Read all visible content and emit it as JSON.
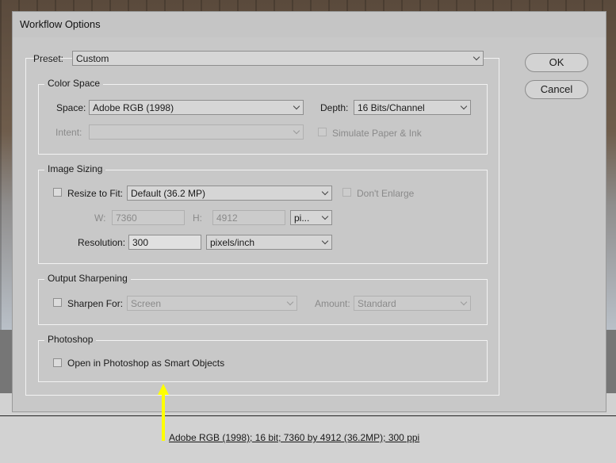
{
  "dialog": {
    "title": "Workflow Options",
    "preset": {
      "label": "Preset:",
      "value": "Custom"
    },
    "ok_label": "OK",
    "cancel_label": "Cancel",
    "color_space": {
      "title": "Color Space",
      "space_label": "Space:",
      "space_value": "Adobe RGB (1998)",
      "depth_label": "Depth:",
      "depth_value": "16 Bits/Channel",
      "intent_label": "Intent:",
      "intent_value": "",
      "simulate_label": "Simulate Paper & Ink"
    },
    "image_sizing": {
      "title": "Image Sizing",
      "resize_label": "Resize to Fit:",
      "resize_value": "Default  (36.2 MP)",
      "dont_enlarge_label": "Don't Enlarge",
      "w_label": "W:",
      "w_value": "7360",
      "h_label": "H:",
      "h_value": "4912",
      "unit_value": "pi...",
      "resolution_label": "Resolution:",
      "resolution_value": "300",
      "resolution_unit": "pixels/inch"
    },
    "output_sharpening": {
      "title": "Output Sharpening",
      "sharpen_label": "Sharpen For:",
      "sharpen_value": "Screen",
      "amount_label": "Amount:",
      "amount_value": "Standard"
    },
    "photoshop": {
      "title": "Photoshop",
      "smart_objects_label": "Open in Photoshop as Smart Objects"
    }
  },
  "status_link": "Adobe RGB (1998); 16 bit; 7360 by 4912 (36.2MP); 300 ppi",
  "colors": {
    "annotation_arrow": "#ffff00",
    "dialog_bg": "#c8c8c8"
  }
}
